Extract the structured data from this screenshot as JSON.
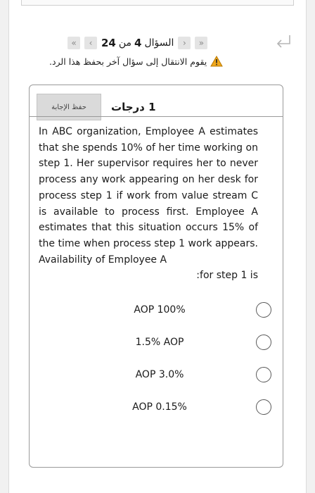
{
  "nav": {
    "question_word": "السؤال",
    "current": "4",
    "of_word": "من",
    "total": "24",
    "first_icon": "double-chevron-left-icon",
    "prev_icon": "chevron-left-icon",
    "next_icon": "chevron-right-icon",
    "last_icon": "double-chevron-right-icon"
  },
  "warning": {
    "text": "يقوم الانتقال إلى سؤال آخر بحفظ هذا الرد.",
    "icon": "warning-icon",
    "icon_color": "#f0a81c"
  },
  "question": {
    "points_label": "1 درجات",
    "save_button": "حفظ الإجابة",
    "body": "In ABC organization, Employee A estimates that she spends 10% of her time working on step 1. Her supervisor requires her to never process any work appearing on her desk for process step 1 if work from value stream C is available to process first. Employee A estimates that this situation occurs 15% of the time when process step 1 work appears. Availability of Employee A",
    "body_tail": ":for step 1 is"
  },
  "choices": [
    {
      "label": "AOP 100%"
    },
    {
      "label": "1.5% AOP"
    },
    {
      "label": "AOP 3.0%"
    },
    {
      "label": "AOP 0.15%"
    }
  ]
}
